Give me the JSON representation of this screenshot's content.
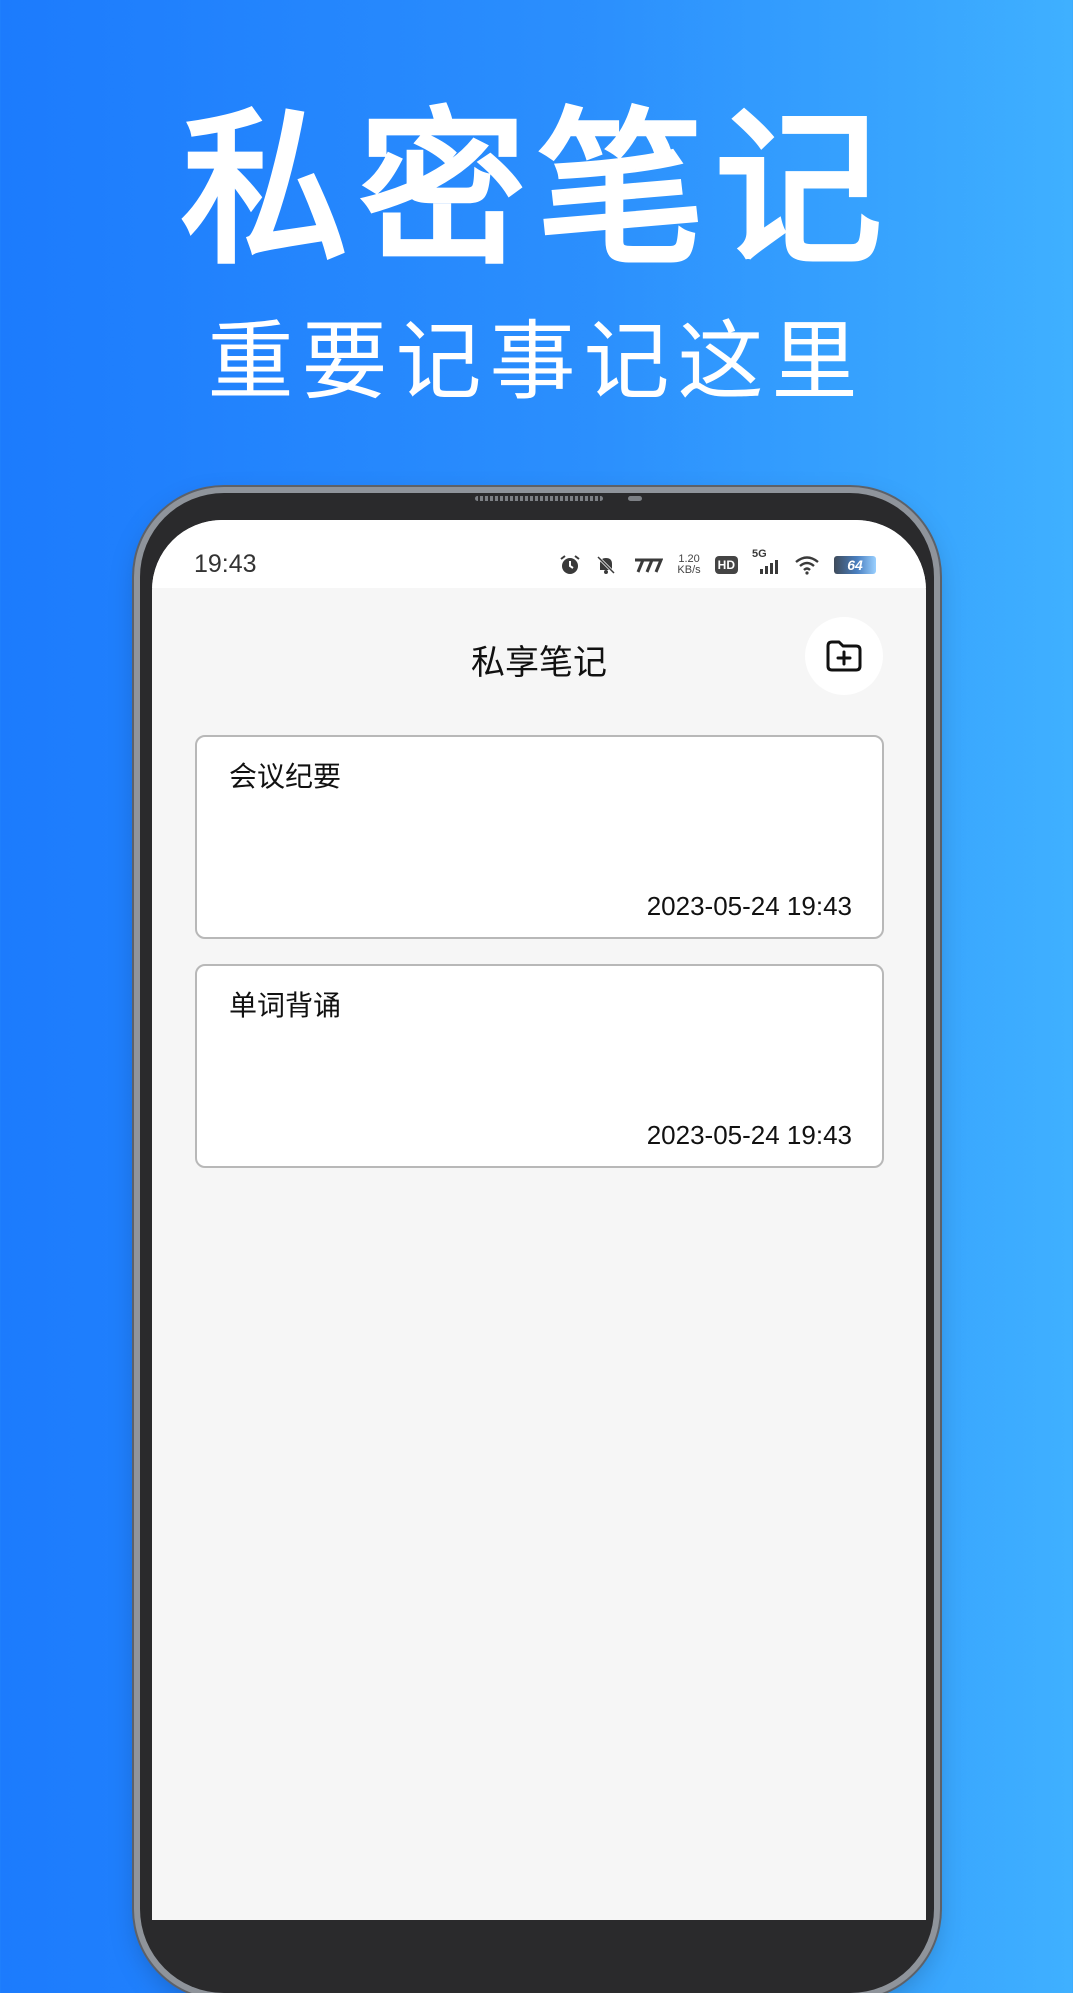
{
  "promo": {
    "headline": "私密笔记",
    "subline": "重要记事记这里"
  },
  "status_bar": {
    "time": "19:43",
    "net_speed_value": "1.20",
    "net_speed_unit": "KB/s",
    "hd_label": "HD",
    "network_label": "5G",
    "battery_level": "64",
    "icons": [
      "alarm-icon",
      "mute-icon",
      "carrier-logo-icon",
      "signal-icon",
      "wifi-icon",
      "battery-icon"
    ]
  },
  "app": {
    "title": "私享笔记",
    "add_icon": "folder-plus-icon"
  },
  "notes": [
    {
      "title": "会议纪要",
      "timestamp": "2023-05-24 19:43"
    },
    {
      "title": "单词背诵",
      "timestamp": "2023-05-24 19:43"
    }
  ],
  "colors": {
    "background_start": "#1c7bfd",
    "background_end": "#3fb0ff",
    "screen_bg": "#f6f6f6",
    "card_border": "#b8b8b8"
  }
}
